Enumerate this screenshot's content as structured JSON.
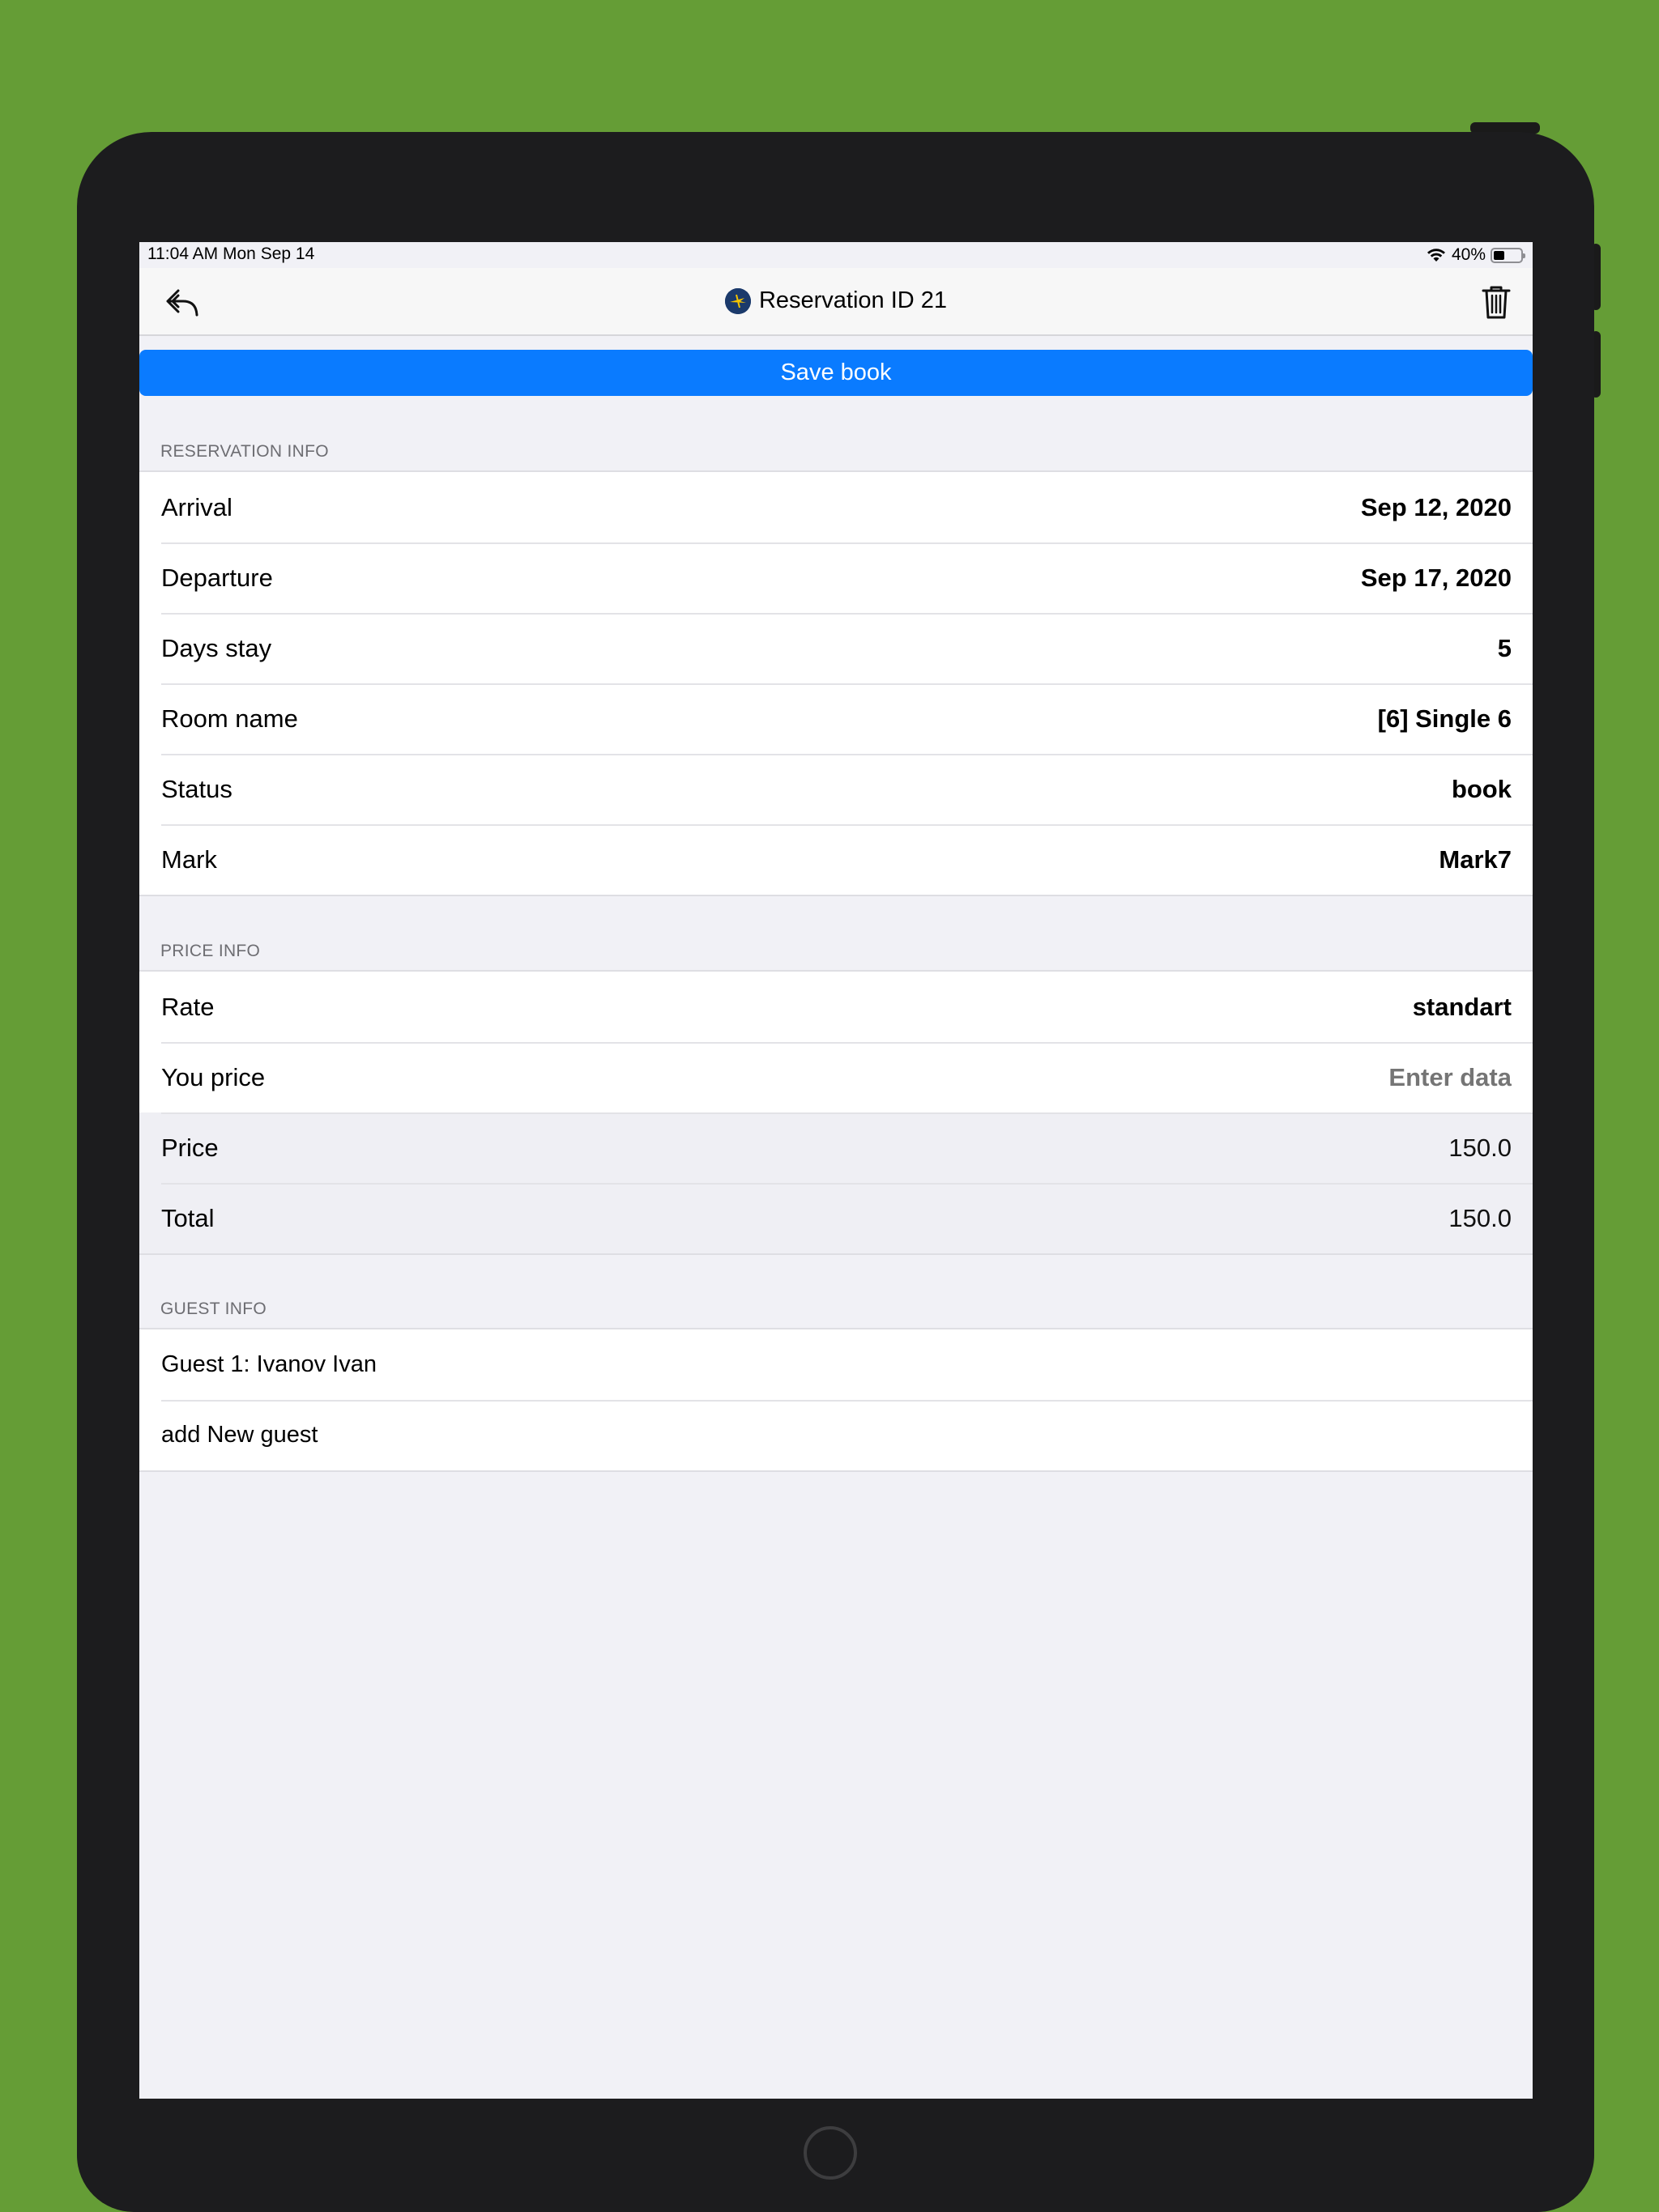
{
  "status_bar": {
    "time_date": "11:04 AM   Mon Sep 14",
    "battery_text": "40%",
    "battery_level": 0.4,
    "wifi_icon": "wifi-icon"
  },
  "nav": {
    "back_icon": "reply-arrow-icon",
    "title": "Reservation ID 21",
    "trash_icon": "trash-icon"
  },
  "save_button": "Save book",
  "reservation_info": {
    "header": "RESERVATION INFO",
    "rows": [
      {
        "label": "Arrival",
        "value": "Sep 12, 2020"
      },
      {
        "label": "Departure",
        "value": "Sep 17, 2020"
      },
      {
        "label": "Days stay",
        "value": "5"
      },
      {
        "label": "Room name",
        "value": "[6] Single 6"
      },
      {
        "label": "Status",
        "value": "book"
      },
      {
        "label": "Mark",
        "value": "Mark7"
      }
    ]
  },
  "price_info": {
    "header": "PRICE INFO",
    "rate": {
      "label": "Rate",
      "value": "standart"
    },
    "you_price": {
      "label": "You price",
      "placeholder": "Enter data",
      "value": ""
    },
    "price": {
      "label": "Price",
      "value": "150.0"
    },
    "total": {
      "label": "Total",
      "value": "150.0"
    }
  },
  "guest_info": {
    "header": "GUEST INFO",
    "guests": [
      "Guest 1: Ivanov  Ivan"
    ],
    "add_label": "add New guest"
  },
  "colors": {
    "background": "#659d36",
    "accent": "#0a7bff",
    "device": "#1c1c1e"
  }
}
